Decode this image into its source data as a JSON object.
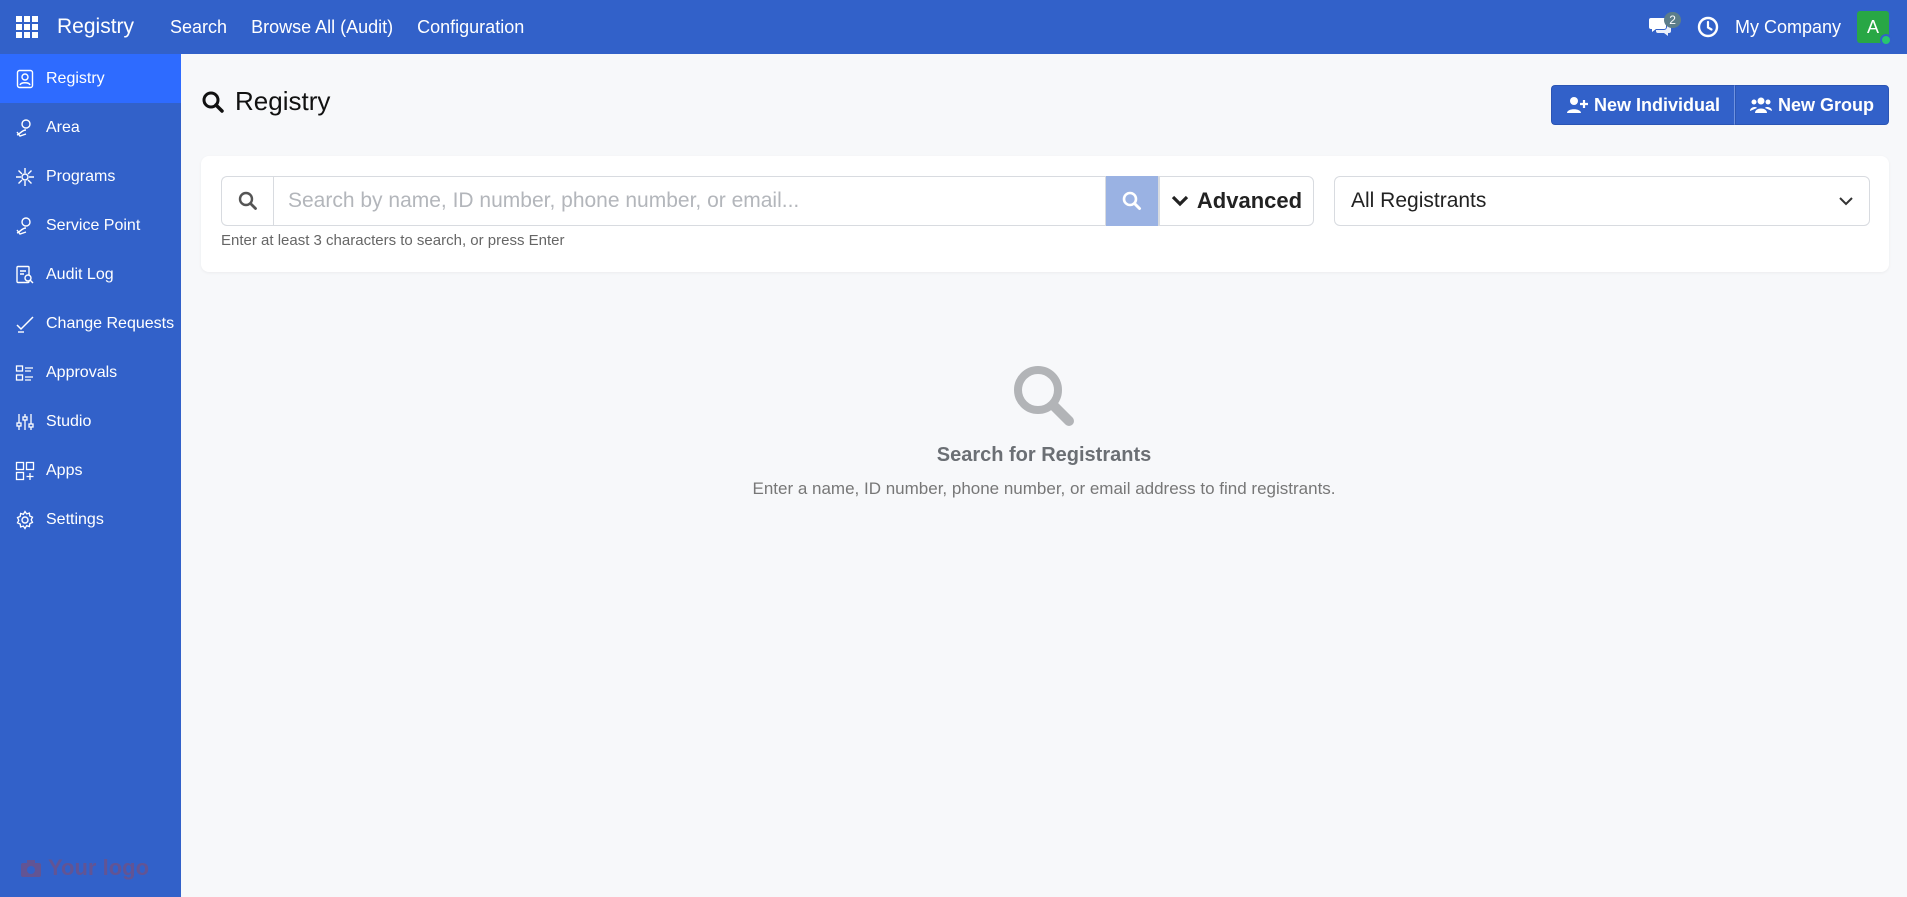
{
  "topbar": {
    "app_name": "Registry",
    "menu": [
      "Search",
      "Browse All (Audit)",
      "Configuration"
    ],
    "chat_count": "2",
    "company": "My Company",
    "avatar_letter": "A"
  },
  "sidebar": {
    "items": [
      {
        "label": "Registry",
        "icon": "registry-icon"
      },
      {
        "label": "Area",
        "icon": "area-icon"
      },
      {
        "label": "Programs",
        "icon": "programs-icon"
      },
      {
        "label": "Service Point",
        "icon": "service-point-icon"
      },
      {
        "label": "Audit Log",
        "icon": "audit-log-icon"
      },
      {
        "label": "Change Requests",
        "icon": "change-requests-icon"
      },
      {
        "label": "Approvals",
        "icon": "approvals-icon"
      },
      {
        "label": "Studio",
        "icon": "studio-icon"
      },
      {
        "label": "Apps",
        "icon": "apps-icon"
      },
      {
        "label": "Settings",
        "icon": "gear-icon"
      }
    ],
    "logo_text": "Your logo"
  },
  "main": {
    "title": "Registry",
    "new_individual": "New Individual",
    "new_group": "New Group",
    "search": {
      "placeholder": "Search by name, ID number, phone number, or email...",
      "value": "",
      "advanced_label": "Advanced",
      "hint": "Enter at least 3 characters to search, or press Enter",
      "filter_selected": "All Registrants"
    },
    "empty": {
      "heading": "Search for Registrants",
      "text": "Enter a name, ID number, phone number, or email address to find registrants."
    }
  },
  "colors": {
    "primary": "#3261c9",
    "active_item": "#2e6bff",
    "search_button": "#9ab2e3",
    "avatar": "#28a745"
  }
}
